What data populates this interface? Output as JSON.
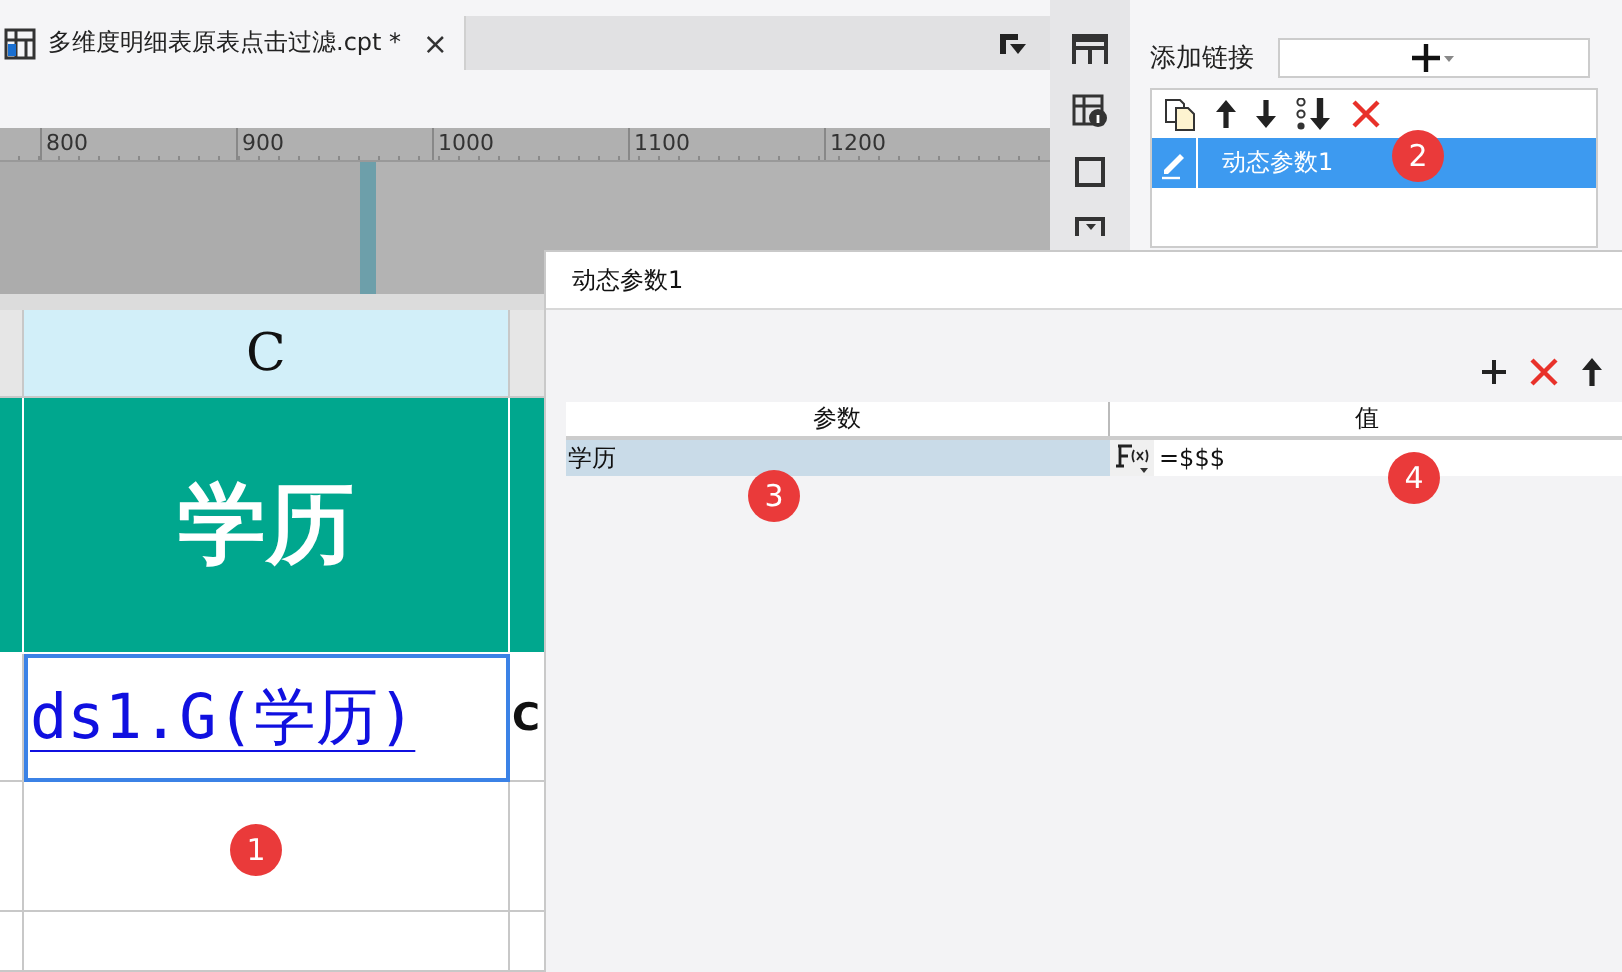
{
  "editor_tab": {
    "title": "多维度明细表原表点击过滤.cpt *",
    "close": "×"
  },
  "ruler": {
    "labels": [
      "800",
      "900",
      "1000",
      "1100",
      "1200"
    ]
  },
  "sheet": {
    "column_header": "C",
    "header_cell": "学历",
    "data_cell": {
      "text": "ds1.G(学历)",
      "selected": true
    },
    "next_cell_text": "C"
  },
  "side_panel": {
    "add_link_label": "添加链接",
    "links": [
      {
        "name": "动态参数1",
        "selected": true
      }
    ]
  },
  "dialog": {
    "title": "动态参数1",
    "columns": [
      "参数",
      "值"
    ],
    "rows": [
      {
        "param": "学历",
        "value": "=$$$",
        "selected": true
      }
    ]
  },
  "markers": [
    "1",
    "2",
    "3",
    "4"
  ]
}
